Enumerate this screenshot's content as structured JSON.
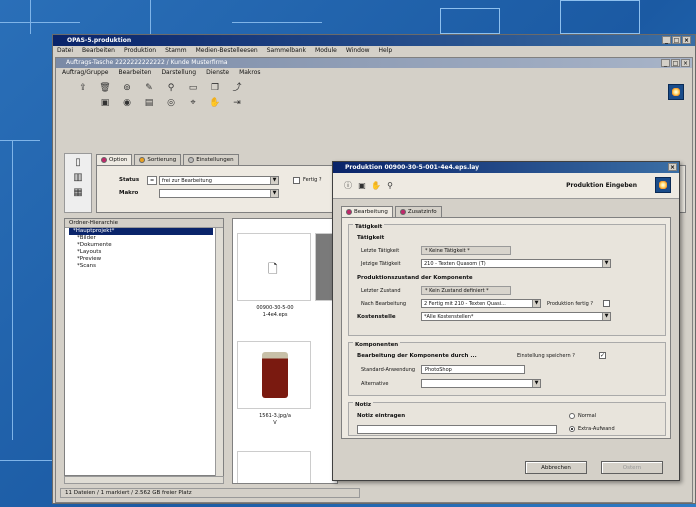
{
  "app": {
    "title": "OPAS-5.produktion",
    "menu": [
      "Datei",
      "Bearbeiten",
      "Produktion",
      "Stamm",
      "Medien-Bestelleesen",
      "Sammelbank",
      "Module",
      "Window",
      "Help"
    ]
  },
  "child": {
    "title": "Auftrags-Tasche 2222222222222 / Kunde Musterfirma",
    "menu": [
      "Auftrag/Gruppe",
      "Bearbeiten",
      "Darstellung",
      "Dienste",
      "Makros"
    ]
  },
  "tabs": [
    {
      "label": "Option",
      "dot": "p"
    },
    {
      "label": "Sortierung",
      "dot": "o"
    },
    {
      "label": "Einstellungen",
      "dot": "g"
    }
  ],
  "options": {
    "status_label": "Status",
    "status_value": "frei zur Bearbeitung",
    "status_prefix": "=",
    "fertig_label": "Fertig ?",
    "makro_label": "Makro",
    "makro_value": ""
  },
  "tree": {
    "header": "Ordner-Hierarchie",
    "items": [
      "*Hauptprojekt*",
      "*Bilder",
      "*Dokumente",
      "*Layouts",
      "*Preview",
      "*Scans"
    ]
  },
  "thumbs": [
    {
      "caption1": "00900-30-5-00",
      "caption2": "1-4e4.eps"
    },
    {
      "caption1": "1561-3.jpg/a",
      "caption2": "V"
    }
  ],
  "status_text": "11 Dateien / 1 markiert / 2.562 GB freier Platz",
  "dialog": {
    "title": "Produktion 00900-30-5-001-4e4.eps.lay",
    "header_title": "Produktion Eingeben",
    "tabs": [
      "Bearbeitung",
      "Zusatzinfo"
    ],
    "taetigkeit_group": "Tätigkeit",
    "taetigkeit_sub": "Tätigkeit",
    "letzte_label": "Letzte Tätigkeit",
    "letzte_value": "* Keine Tätigkeit *",
    "jetzige_label": "Jetzige Tätigkeit",
    "jetzige_value": "210 - Texten Quasom (T)",
    "produktion_sub": "Produktionszustand der Komponente",
    "letzter_zustand_label": "Letzter Zustand",
    "letzter_zustand_value": "* Kein Zustand definiert *",
    "nach_bearbeitung_label": "Nach Bearbeitung",
    "nach_bearbeitung_value": "2 Fertig mit 210 - Texten Quasi...",
    "produktion_fertig_label": "Produktion fertig ?",
    "kostenstelle_label": "Kostenstelle",
    "kostenstelle_value": "*Alle Kostenstellen*",
    "komponenten_group": "Komponenten",
    "bearbeitung_durch_label": "Bearbeitung der Komponente durch ...",
    "einstellung_label": "Einstellung speichern ?",
    "einstellung_check": "✓",
    "standard_label": "Standard-Anwendung",
    "standard_value": "PhotoShop",
    "alternative_label": "Alternative",
    "alternative_value": "",
    "notiz_group": "Notiz",
    "notiz_label": "Notiz eintragen",
    "notiz_value": "",
    "radio_normal": "Normal",
    "radio_extra": "Extra-Aufwand",
    "btn_cancel": "Abbrechen",
    "btn_ok": "Ostern"
  },
  "colors": {
    "desktop": "#1b5aa3",
    "titlebar": "#0a246a",
    "window": "#d4d0c8"
  }
}
